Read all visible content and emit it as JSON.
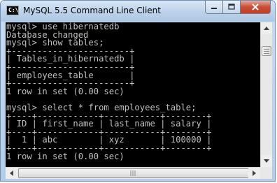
{
  "window": {
    "title": "MySQL 5.5 Command Line Client",
    "icon": "console-app-icon",
    "icon_text": "C:\\"
  },
  "console": {
    "lines": [
      "mysql> use hibernatedb",
      "Database changed",
      "mysql> show tables;",
      "+-----------------------+",
      "| Tables_in_hibernatedb |",
      "+-----------------------+",
      "| employees_table       |",
      "+-----------------------+",
      "1 row in set (0.00 sec)",
      "",
      "mysql> select * from employees_table;",
      "+----+------------+-----------+--------+",
      "| ID | first_name | last_name | salary |",
      "+----+------------+-----------+--------+",
      "|  1 | abc        | xyz       | 100000 |",
      "+----+------------+-----------+--------+",
      "1 row in set (0.00 sec)"
    ]
  },
  "colors": {
    "console_bg": "#000000",
    "console_text": "#c0c0c0",
    "title_bar": "#bcd2ea",
    "close_button": "#c84d35"
  }
}
